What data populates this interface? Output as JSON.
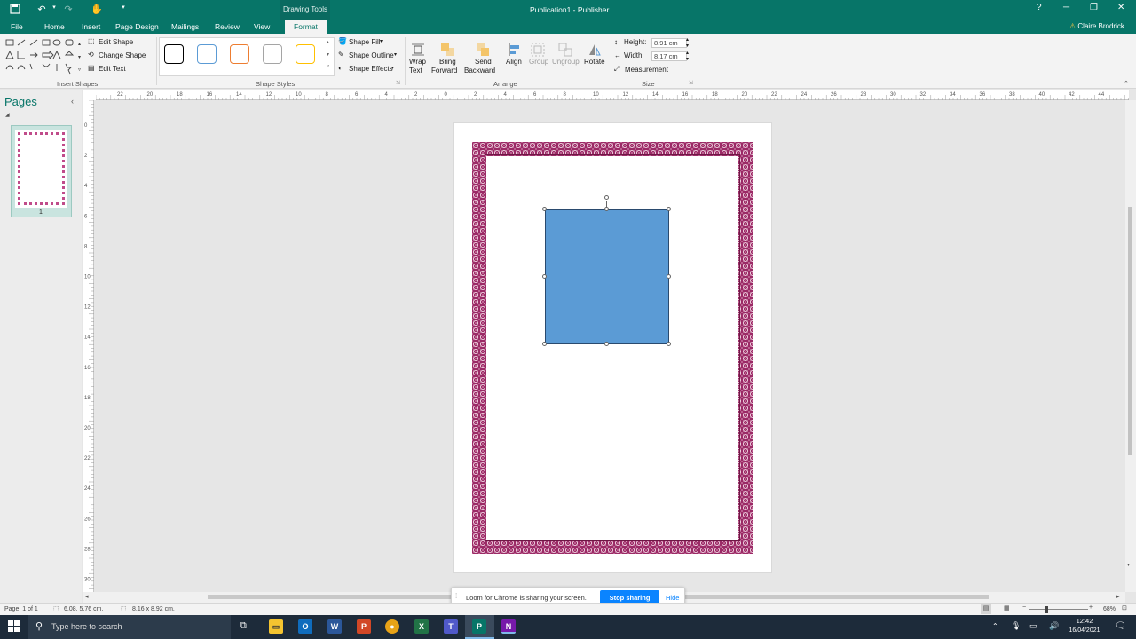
{
  "title_bar": {
    "document_title": "Publication1 - Publisher",
    "context_tab_group": "Drawing Tools",
    "user_name": "Claire Brodrick",
    "help": "?"
  },
  "tabs": [
    "File",
    "Home",
    "Insert",
    "Page Design",
    "Mailings",
    "Review",
    "View",
    "Format"
  ],
  "active_tab": "Format",
  "ribbon": {
    "insert_shapes": {
      "edit_shape": "Edit Shape",
      "change_shape": "Change Shape",
      "edit_text": "Edit Text",
      "label": "Insert Shapes"
    },
    "shape_styles": {
      "swatch_colors": [
        "#000000",
        "#5b9bd5",
        "#ed7d31",
        "#a5a5a5",
        "#ffc000"
      ],
      "shape_fill": "Shape Fill",
      "shape_outline": "Shape Outline",
      "shape_effects": "Shape Effects",
      "label": "Shape Styles"
    },
    "arrange": {
      "wrap_text_1": "Wrap",
      "wrap_text_2": "Text",
      "bring_forward_1": "Bring",
      "bring_forward_2": "Forward",
      "send_backward_1": "Send",
      "send_backward_2": "Backward",
      "align": "Align",
      "group": "Group",
      "ungroup": "Ungroup",
      "rotate": "Rotate",
      "label": "Arrange"
    },
    "size": {
      "height_label": "Height:",
      "height_value": "8.91 cm",
      "width_label": "Width:",
      "width_value": "8.17 cm",
      "measurement": "Measurement",
      "label": "Size"
    }
  },
  "pages_pane": {
    "title": "Pages",
    "page_number": "1"
  },
  "ruler_h_labels": [
    "22",
    "20",
    "18",
    "16",
    "14",
    "12",
    "10",
    "8",
    "6",
    "4",
    "2",
    "0",
    "2",
    "4",
    "6",
    "8",
    "10",
    "12",
    "14",
    "16",
    "18",
    "20",
    "22",
    "24",
    "26",
    "28",
    "30",
    "32",
    "34",
    "36",
    "38",
    "40",
    "42",
    "44"
  ],
  "ruler_v_labels": [
    "0",
    "2",
    "4",
    "6",
    "8",
    "10",
    "12",
    "14",
    "16",
    "18",
    "20",
    "22",
    "24",
    "26",
    "28",
    "30"
  ],
  "status_bar": {
    "page": "Page: 1 of 1",
    "position": "6.08, 5.76 cm.",
    "size": "8.16 x 8.92 cm.",
    "zoom": "68%"
  },
  "share_notification": {
    "message": "Loom for Chrome is sharing your screen.",
    "stop_button": "Stop sharing",
    "hide_link": "Hide"
  },
  "taskbar": {
    "search_placeholder": "Type here to search",
    "time": "12:42",
    "date": "16/04/2021",
    "app_colors": {
      "explorer": "#f4c430",
      "outlook": "#0f6cbd",
      "word": "#2b579a",
      "powerpoint": "#d24726",
      "chrome": "#e8a317",
      "excel": "#217346",
      "teams": "#5059c9",
      "publisher": "#077568",
      "onenote": "#7719aa"
    }
  },
  "colors": {
    "accent": "#077568",
    "shape_fill": "#5b9bd5",
    "border": "#9b2a66",
    "stop_button": "#0a84ff"
  }
}
